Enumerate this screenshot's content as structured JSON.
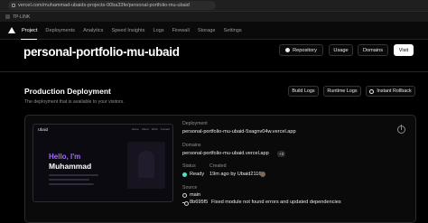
{
  "browser": {
    "url": "vercel.com/muhammad-ubaids-projects-00ba33fe/personal-portfolio-mu-ubaid",
    "bookmark": "TP-LINK"
  },
  "header": {
    "tabs": [
      "Project",
      "Deployments",
      "Analytics",
      "Speed Insights",
      "Logs",
      "Firewall",
      "Storage",
      "Settings"
    ]
  },
  "project": {
    "title": "personal-portfolio-mu-ubaid",
    "buttons": {
      "repository": "Repository",
      "usage": "Usage",
      "domains": "Domains",
      "visit": "Visit"
    }
  },
  "production": {
    "title": "Production Deployment",
    "subtitle": "The deployment that is available to your visitors.",
    "buttons": {
      "build_logs": "Build Logs",
      "runtime_logs": "Runtime Logs",
      "instant_rollback": "Instant Rollback"
    }
  },
  "preview": {
    "logo": "Ubaid",
    "links": [
      "Home",
      "About",
      "Work",
      "Contact"
    ],
    "hello": "Hello, I'm",
    "name": "Muhammad"
  },
  "deployment": {
    "deployment_label": "Deployment",
    "deployment_url": "personal-portfolio-mu-ubaid-5sagnv04w.vercel.app",
    "domains_label": "Domains",
    "domain": "personal-portfolio-mu-ubaid.vercel.app",
    "domains_more": "+3",
    "status_label": "Status",
    "status": "Ready",
    "created_label": "Created",
    "created": "19m ago by Ubaid2116",
    "source_label": "Source",
    "branch": "main",
    "commit_hash": "8b695f5",
    "commit_message": "Fixed module not found errors and updated dependencies",
    "status_color": "#50e3c2"
  }
}
